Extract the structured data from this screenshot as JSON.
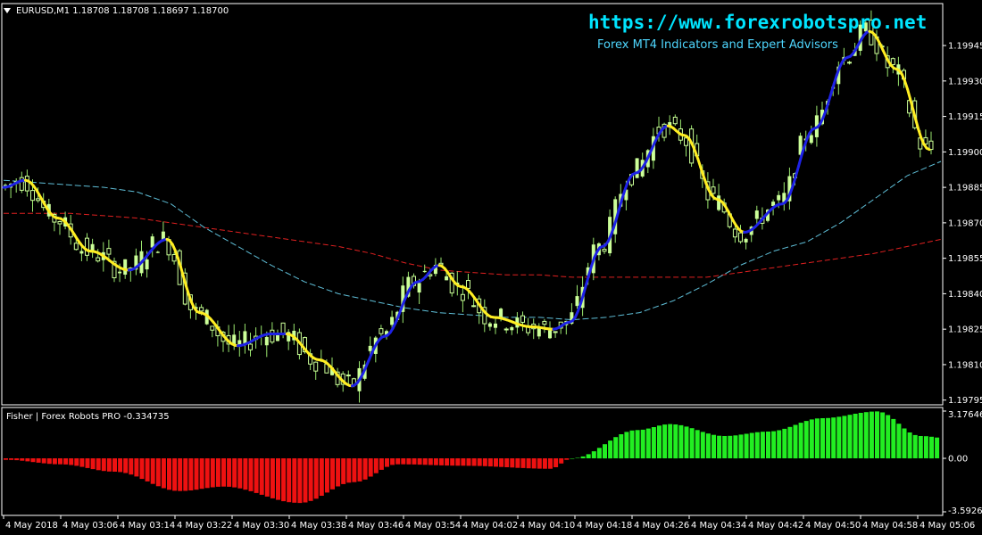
{
  "header": {
    "symbol_info": "EURUSD,M1  1.18708 1.18708 1.18697 1.18700"
  },
  "watermark": {
    "url": "https://www.forexrobotspro.net",
    "subtitle": "Forex MT4 Indicators and Expert Advisors"
  },
  "indicator": {
    "label": "Fisher | Forex Robots PRO -0.334735"
  },
  "colors": {
    "background": "#000000",
    "frame": "#ffffff",
    "bull_candle": "#ccff99",
    "wick": "#9ae66e",
    "line_down": "#ffee22",
    "line_up": "#1e22e6",
    "ma_fast": "#5fbfd8",
    "ma_slow": "#e02020",
    "hist_pos": "#22ee22",
    "hist_neg": "#ee1111"
  },
  "chart_data": {
    "type": "candlestick",
    "price_axis": {
      "ticks": [
        "1.19945",
        "1.19930",
        "1.19915",
        "1.19900",
        "1.19885",
        "1.19870",
        "1.19855",
        "1.19840",
        "1.19825",
        "1.19810",
        "1.19795"
      ],
      "range": [
        1.19793,
        1.19962
      ]
    },
    "time_axis": {
      "ticks": [
        "4 May 2018",
        "4 May 03:06",
        "4 May 03:14",
        "4 May 03:22",
        "4 May 03:30",
        "4 May 03:38",
        "4 May 03:46",
        "4 May 03:54",
        "4 May 04:02",
        "4 May 04:10",
        "4 May 04:18",
        "4 May 04:26",
        "4 May 04:34",
        "4 May 04:42",
        "4 May 04:50",
        "4 May 04:58",
        "4 May 05:06"
      ]
    },
    "indicator_axis": {
      "ticks": [
        "3.176461",
        "0.00",
        "-3.592693"
      ],
      "range": [
        -3.592693,
        3.176461
      ]
    },
    "signal_line": [
      {
        "t": 0,
        "v": 1.19885
      },
      {
        "t": 4,
        "v": 1.19888
      },
      {
        "t": 10,
        "v": 1.19872
      },
      {
        "t": 16,
        "v": 1.19858
      },
      {
        "t": 23,
        "v": 1.1985
      },
      {
        "t": 30,
        "v": 1.19863
      },
      {
        "t": 36,
        "v": 1.19832
      },
      {
        "t": 43,
        "v": 1.19818
      },
      {
        "t": 49,
        "v": 1.19823
      },
      {
        "t": 52,
        "v": 1.19823
      },
      {
        "t": 58,
        "v": 1.19812
      },
      {
        "t": 64,
        "v": 1.19801
      },
      {
        "t": 70,
        "v": 1.19822
      },
      {
        "t": 76,
        "v": 1.19845
      },
      {
        "t": 80,
        "v": 1.19852
      },
      {
        "t": 84,
        "v": 1.19843
      },
      {
        "t": 90,
        "v": 1.1983
      },
      {
        "t": 97,
        "v": 1.19826
      },
      {
        "t": 101,
        "v": 1.19825
      },
      {
        "t": 104,
        "v": 1.19828
      },
      {
        "t": 110,
        "v": 1.1986
      },
      {
        "t": 116,
        "v": 1.19891
      },
      {
        "t": 122,
        "v": 1.19911
      },
      {
        "t": 125,
        "v": 1.19907
      },
      {
        "t": 131,
        "v": 1.1988
      },
      {
        "t": 136,
        "v": 1.19866
      },
      {
        "t": 143,
        "v": 1.19878
      },
      {
        "t": 149,
        "v": 1.1991
      },
      {
        "t": 155,
        "v": 1.1994
      },
      {
        "t": 159,
        "v": 1.19951
      },
      {
        "t": 164,
        "v": 1.19935
      },
      {
        "t": 170,
        "v": 1.19901
      }
    ],
    "ma_fast": [
      1.19888,
      1.19887,
      1.19886,
      1.19885,
      1.19883,
      1.19878,
      1.19868,
      1.1986,
      1.19852,
      1.19845,
      1.1984,
      1.19837,
      1.19834,
      1.19832,
      1.19831,
      1.1983,
      1.1983,
      1.19829,
      1.1983,
      1.19832,
      1.19837,
      1.19844,
      1.19852,
      1.19858,
      1.19862,
      1.1987,
      1.1988,
      1.1989,
      1.19896
    ],
    "ma_slow": [
      1.19874,
      1.19874,
      1.19874,
      1.19873,
      1.19872,
      1.1987,
      1.19868,
      1.19866,
      1.19864,
      1.19862,
      1.1986,
      1.19857,
      1.19853,
      1.1985,
      1.19849,
      1.19848,
      1.19848,
      1.19847,
      1.19847,
      1.19847,
      1.19847,
      1.19847,
      1.19849,
      1.19851,
      1.19853,
      1.19855,
      1.19857,
      1.1986,
      1.19863
    ],
    "histogram_anchors": [
      {
        "t": 0,
        "v": -0.1
      },
      {
        "t": 10,
        "v": -0.4
      },
      {
        "t": 20,
        "v": -0.9
      },
      {
        "t": 32,
        "v": -2.2
      },
      {
        "t": 40,
        "v": -1.9
      },
      {
        "t": 54,
        "v": -3.0
      },
      {
        "t": 64,
        "v": -1.6
      },
      {
        "t": 72,
        "v": -0.4
      },
      {
        "t": 84,
        "v": -0.5
      },
      {
        "t": 100,
        "v": -0.7
      },
      {
        "t": 104,
        "v": 0.0
      },
      {
        "t": 116,
        "v": 1.9
      },
      {
        "t": 122,
        "v": 2.3
      },
      {
        "t": 132,
        "v": 1.5
      },
      {
        "t": 140,
        "v": 1.8
      },
      {
        "t": 150,
        "v": 2.7
      },
      {
        "t": 160,
        "v": 3.15
      },
      {
        "t": 168,
        "v": 1.5
      },
      {
        "t": 180,
        "v": 0.8
      }
    ]
  }
}
